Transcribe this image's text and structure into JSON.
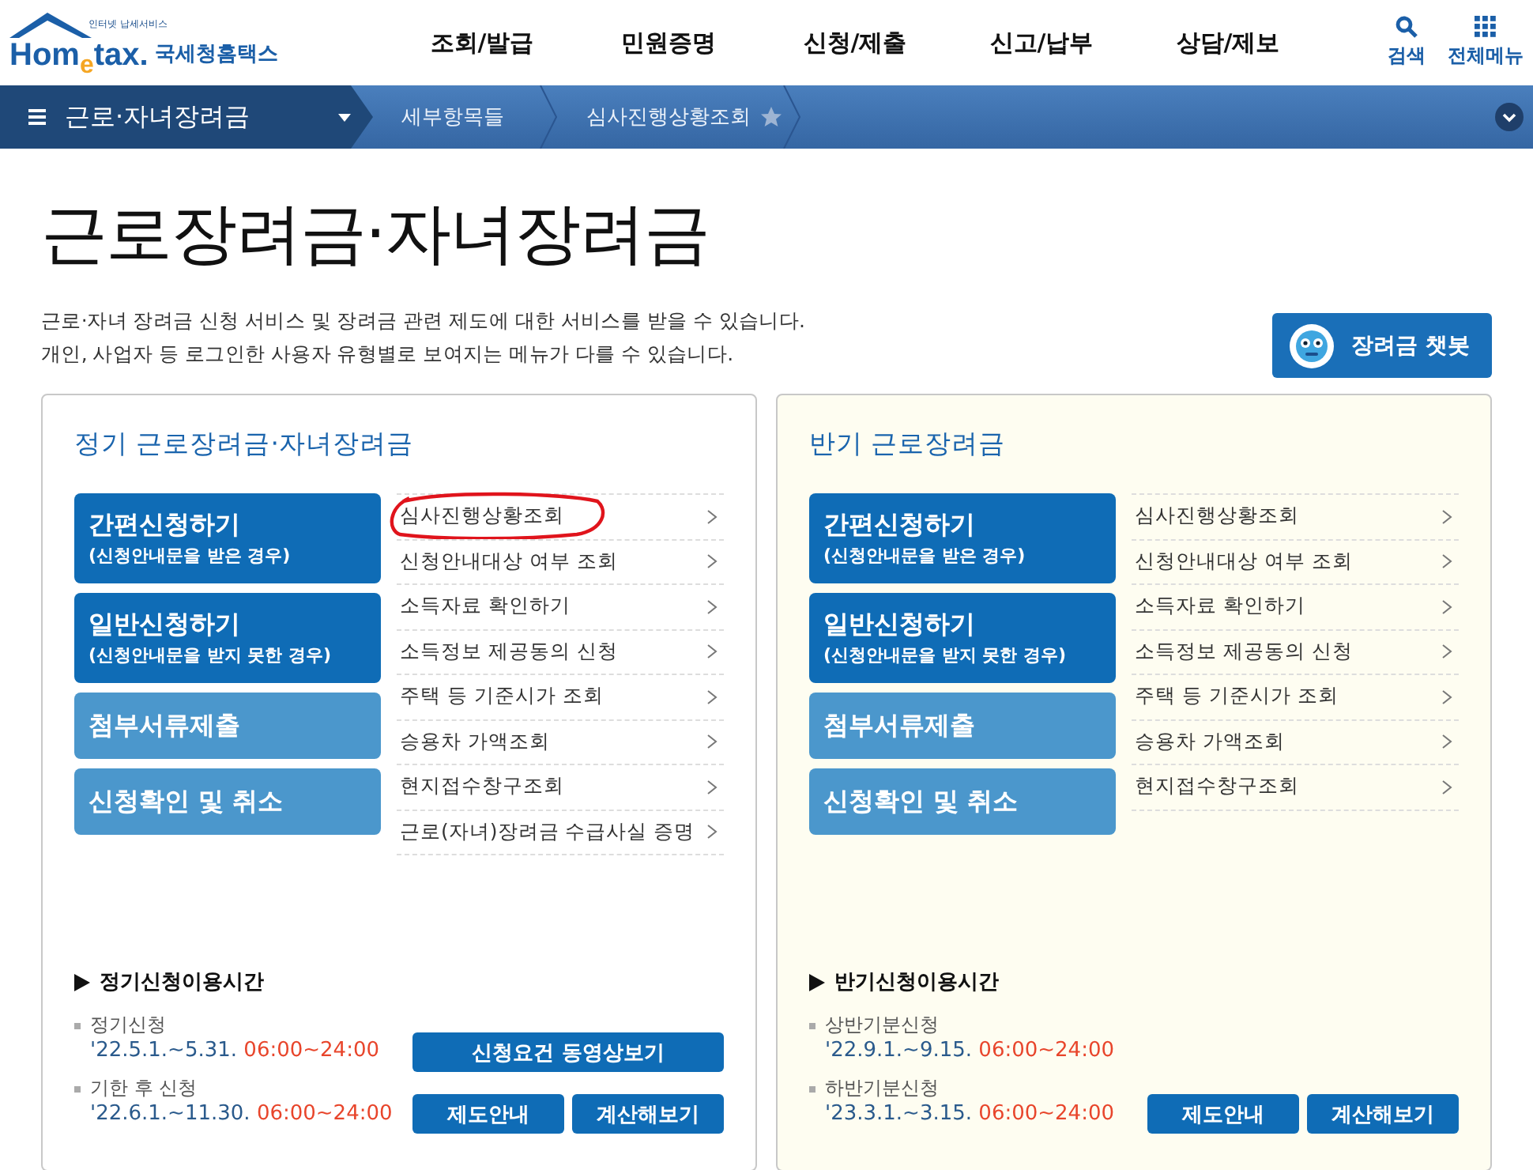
{
  "header": {
    "logo": {
      "tagline": "인터넷 납세서비스",
      "wordmark": "Hom$_{e}$tax.",
      "name": "국세청홈택스"
    },
    "nav": [
      "조회/발급",
      "민원증명",
      "신청/제출",
      "신고/납부",
      "상담/제보"
    ],
    "tools": [
      {
        "kind": "search",
        "label": "검색"
      },
      {
        "kind": "grid",
        "label": "전체메뉴"
      }
    ]
  },
  "breadcrumb": {
    "menu": "근로·자녀장려금",
    "items": [
      "세부항목들",
      "심사진행상황조회"
    ]
  },
  "intro": {
    "title": "근로장려금·자녀장려금",
    "description": [
      "근로·자녀 장려금 신청 서비스 및 장려금 관련 제도에 대한 서비스를 받을 수 있습니다.",
      "개인, 사업자 등 로그인한 사용자 유형별로 보여지는 메뉴가 다를 수 있습니다."
    ],
    "chatbot": "장려금 챗봇"
  },
  "panels": [
    {
      "color": "#ffffff",
      "title": "정기 근로장려금·자녀장려금",
      "actions": [
        {
          "kind": "primary",
          "label": "간편신청하기",
          "note": "(신청안내문을 받은 경우)"
        },
        {
          "kind": "primary",
          "label": "일반신청하기",
          "note": "(신청안내문을 받지 못한 경우)"
        },
        {
          "kind": "secondary",
          "label": "첨부서류제출"
        },
        {
          "kind": "secondary",
          "label": "신청확인 및 취소"
        }
      ],
      "links": [
        {
          "label": "심사진행상황조회",
          "circled": true
        },
        {
          "label": "신청안내대상 여부 조회",
          "circled": false
        },
        {
          "label": "소득자료 확인하기",
          "circled": false
        },
        {
          "label": "소득정보 제공동의 신청",
          "circled": false
        },
        {
          "label": "주택 등 기준시가 조회",
          "circled": false
        },
        {
          "label": "승용차 가액조회",
          "circled": false
        },
        {
          "label": "현지접수창구조회",
          "circled": false
        },
        {
          "label": "근로(자녀)장려금 수급사실 증명",
          "circled": false
        }
      ],
      "hours_title": "정기신청이용시간",
      "hours": [
        {
          "label": "정기신청",
          "period": "'22.5.1.~5.31.",
          "time": "06:00~24:00"
        },
        {
          "label": "기한 후 신청",
          "period": "'22.6.1.~11.30.",
          "time": "06:00~24:00"
        }
      ],
      "button_rows": [
        [
          "신청요건 동영상보기"
        ],
        [
          "제도안내",
          "계산해보기"
        ]
      ]
    },
    {
      "color": "#fefdf1",
      "title": "반기 근로장려금",
      "actions": [
        {
          "kind": "primary",
          "label": "간편신청하기",
          "note": "(신청안내문을 받은 경우)"
        },
        {
          "kind": "primary",
          "label": "일반신청하기",
          "note": "(신청안내문을 받지 못한 경우)"
        },
        {
          "kind": "secondary",
          "label": "첨부서류제출"
        },
        {
          "kind": "secondary",
          "label": "신청확인 및 취소"
        }
      ],
      "links": [
        {
          "label": "심사진행상황조회",
          "circled": false
        },
        {
          "label": "신청안내대상 여부 조회",
          "circled": false
        },
        {
          "label": "소득자료 확인하기",
          "circled": false
        },
        {
          "label": "소득정보 제공동의 신청",
          "circled": false
        },
        {
          "label": "주택 등 기준시가 조회",
          "circled": false
        },
        {
          "label": "승용차 가액조회",
          "circled": false
        },
        {
          "label": "현지접수창구조회",
          "circled": false
        }
      ],
      "hours_title": "반기신청이용시간",
      "hours": [
        {
          "label": "상반기분신청",
          "period": "'22.9.1.~9.15.",
          "time": "06:00~24:00"
        },
        {
          "label": "하반기분신청",
          "period": "'23.3.1.~3.15.",
          "time": "06:00~24:00"
        }
      ],
      "button_rows": [
        [
          "제도안내",
          "계산해보기"
        ]
      ]
    }
  ]
}
